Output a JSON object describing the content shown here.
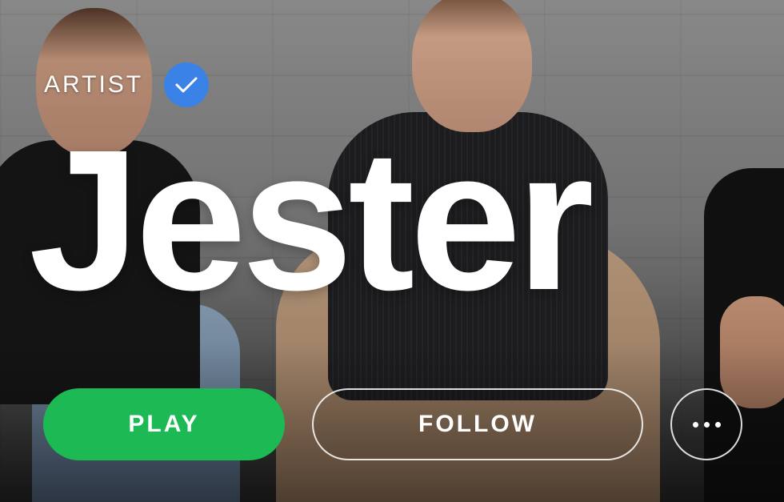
{
  "artist": {
    "type_label": "ARTIST",
    "verified": true,
    "name": "Jester"
  },
  "actions": {
    "play_label": "PLAY",
    "follow_label": "FOLLOW",
    "more_icon": "more-options-icon"
  },
  "colors": {
    "play_button": "#1db954",
    "verified_badge": "#3b82e6",
    "text": "#ffffff"
  }
}
